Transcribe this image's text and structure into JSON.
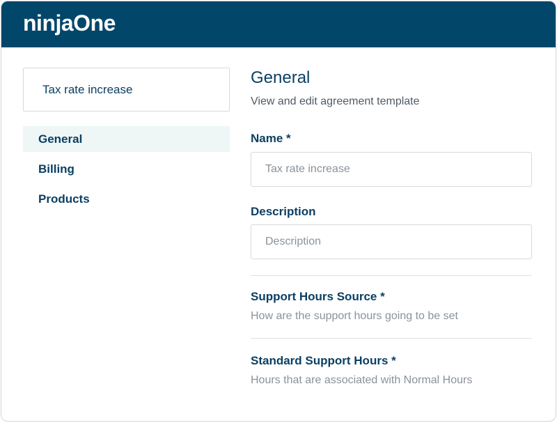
{
  "header": {
    "logo": "ninjaOne"
  },
  "agreement": {
    "title": "Tax rate increase"
  },
  "sidebar": {
    "items": [
      {
        "label": "General",
        "active": true
      },
      {
        "label": "Billing",
        "active": false
      },
      {
        "label": "Products",
        "active": false
      }
    ]
  },
  "main": {
    "title": "General",
    "subtitle": "View and edit agreement template",
    "name": {
      "label": "Name *",
      "placeholder": "Tax rate increase",
      "value": ""
    },
    "description": {
      "label": "Description",
      "placeholder": "Description",
      "value": ""
    },
    "support_hours_source": {
      "label": "Support Hours Source *",
      "helper": "How are the support hours going to be set"
    },
    "standard_support_hours": {
      "label": "Standard Support Hours *",
      "helper": "Hours that are associated with Normal Hours"
    }
  },
  "colors": {
    "brand": "#02466a",
    "text_primary": "#0b3f63",
    "active_bg": "#eef6f6"
  }
}
